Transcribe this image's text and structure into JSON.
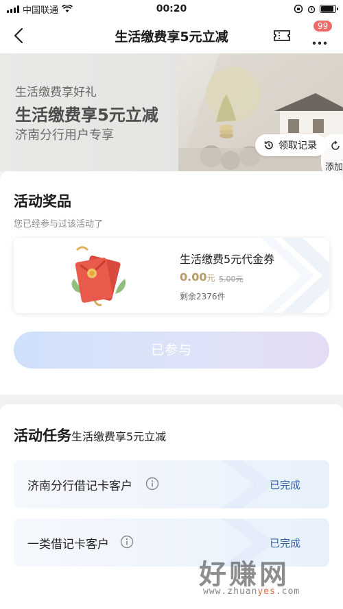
{
  "status_bar": {
    "carrier": "中国联通",
    "time": "00:20"
  },
  "nav": {
    "title": "生活缴费享5元立减",
    "badge_count": "99"
  },
  "banner": {
    "subtitle": "生活缴费享好礼",
    "title": "生活缴费享5元立减",
    "note": "济南分行用户专享",
    "record_button": "领取记录",
    "add_label": "添加"
  },
  "prize": {
    "section_title": "活动奖品",
    "section_sub": "您已经参与过该活动了",
    "name": "生活缴费5元代金券",
    "price_value": "0.00",
    "price_unit": "元",
    "original_price": "5.00元",
    "stock": "剩余2376件",
    "join_button": "已参与"
  },
  "tasks": {
    "section_title": "活动任务",
    "section_sub": "生活缴费享5元立减",
    "items": [
      {
        "label": "济南分行借记卡客户",
        "status": "已完成"
      },
      {
        "label": "一类借记卡客户",
        "status": "已完成"
      }
    ]
  },
  "watermark": {
    "big": "好赚网",
    "small_a": "www.zhuan",
    "small_b": "yes",
    "small_c": ".com"
  },
  "colors": {
    "accent_gold": "#b59a6a",
    "status_blue": "#2f5fa8",
    "badge_red": "#f06a6a"
  }
}
